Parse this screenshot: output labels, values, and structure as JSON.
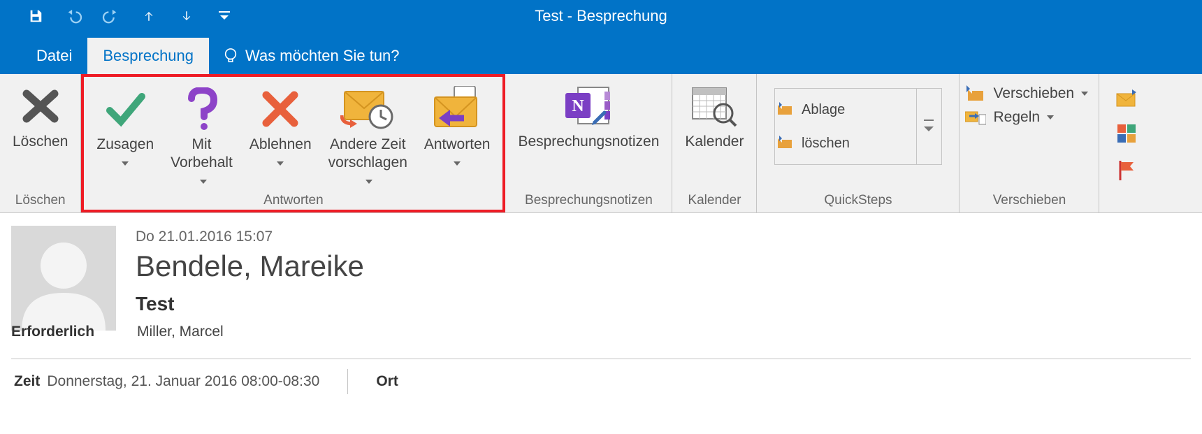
{
  "window": {
    "title": "Test - Besprechung"
  },
  "qat": {
    "save": "save",
    "undo": "undo",
    "redo": "redo",
    "prev": "prev",
    "next": "next",
    "custom": "customize"
  },
  "tabs": {
    "file": "Datei",
    "active": "Besprechung",
    "tellme": "Was möchten Sie tun?"
  },
  "ribbon": {
    "delete": {
      "button": "Löschen",
      "group": "Löschen"
    },
    "respond": {
      "accept": "Zusagen",
      "tentative": "Mit\nVorbehalt",
      "decline": "Ablehnen",
      "propose": "Andere Zeit\nvorschlagen",
      "reply": "Antworten",
      "group": "Antworten"
    },
    "notes": {
      "button": "Besprechungsnotizen",
      "group": "Besprechungsnotizen"
    },
    "calendar": {
      "button": "Kalender",
      "group": "Kalender"
    },
    "quicksteps": {
      "item1": "Ablage",
      "item2": "löschen",
      "group": "QuickSteps"
    },
    "move": {
      "move": "Verschieben",
      "rules": "Regeln",
      "group": "Verschieben"
    }
  },
  "message": {
    "date": "Do 21.01.2016 15:07",
    "sender": "Bendele, Mareike",
    "subject": "Test",
    "required_label": "Erforderlich",
    "required_value": "Miller, Marcel",
    "time_label": "Zeit",
    "time_value": "Donnerstag, 21. Januar 2016 08:00-08:30",
    "location_label": "Ort",
    "location_value": ""
  }
}
